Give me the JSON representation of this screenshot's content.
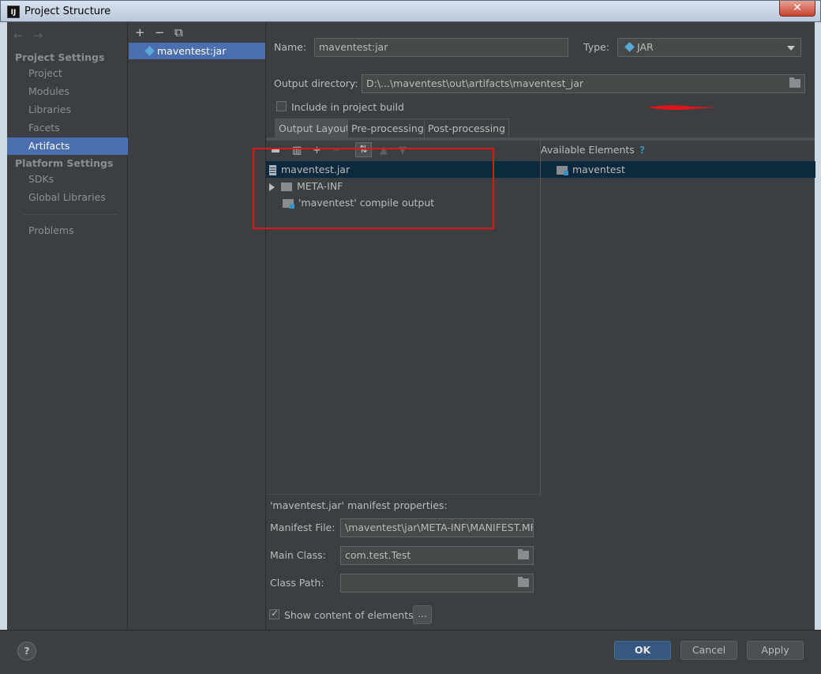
{
  "window": {
    "title": "Project Structure",
    "app_icon": "IJ"
  },
  "nav": {
    "project_settings": "Project Settings",
    "items_project": [
      "Project",
      "Modules",
      "Libraries",
      "Facets",
      "Artifacts"
    ],
    "platform_settings": "Platform Settings",
    "items_platform": [
      "SDKs",
      "Global Libraries"
    ],
    "problems": "Problems",
    "selected": "Artifacts"
  },
  "artifacts": {
    "add": "+",
    "remove": "−",
    "copy": "⧉",
    "items": [
      "maventest:jar"
    ]
  },
  "config": {
    "name_label": "Name:",
    "name_value": "maventest:jar",
    "type_label": "Type:",
    "type_value": "JAR",
    "output_label": "Output directory:",
    "output_value": "D:\\...\\maventest\\out\\artifacts\\maventest_jar",
    "include_label": "Include in project build",
    "include_checked": false,
    "tabs": [
      "Output Layout",
      "Pre-processing",
      "Post-processing"
    ],
    "active_tab": "Output Layout"
  },
  "layout": {
    "tree": [
      {
        "label": "maventest.jar",
        "icon": "jar-icon",
        "selected": true
      },
      {
        "label": "META-INF",
        "icon": "folder-icon",
        "expandable": true
      },
      {
        "label": "'maventest' compile output",
        "icon": "module-folder-icon"
      }
    ],
    "available_title": "Available Elements",
    "available_help": "?",
    "available_items": [
      "maventest"
    ]
  },
  "manifest": {
    "heading": "'maventest.jar' manifest properties:",
    "file_label": "Manifest File:",
    "file_value": "\\maventest\\jar\\META-INF\\MANIFEST.MF",
    "main_class_label": "Main Class:",
    "main_class_value": "com.test.Test",
    "class_path_label": "Class Path:",
    "class_path_value": "",
    "show_content_label": "Show content of elements",
    "show_content_checked": true,
    "more_button": "..."
  },
  "buttons": {
    "help": "?",
    "ok": "OK",
    "cancel": "Cancel",
    "apply": "Apply"
  }
}
